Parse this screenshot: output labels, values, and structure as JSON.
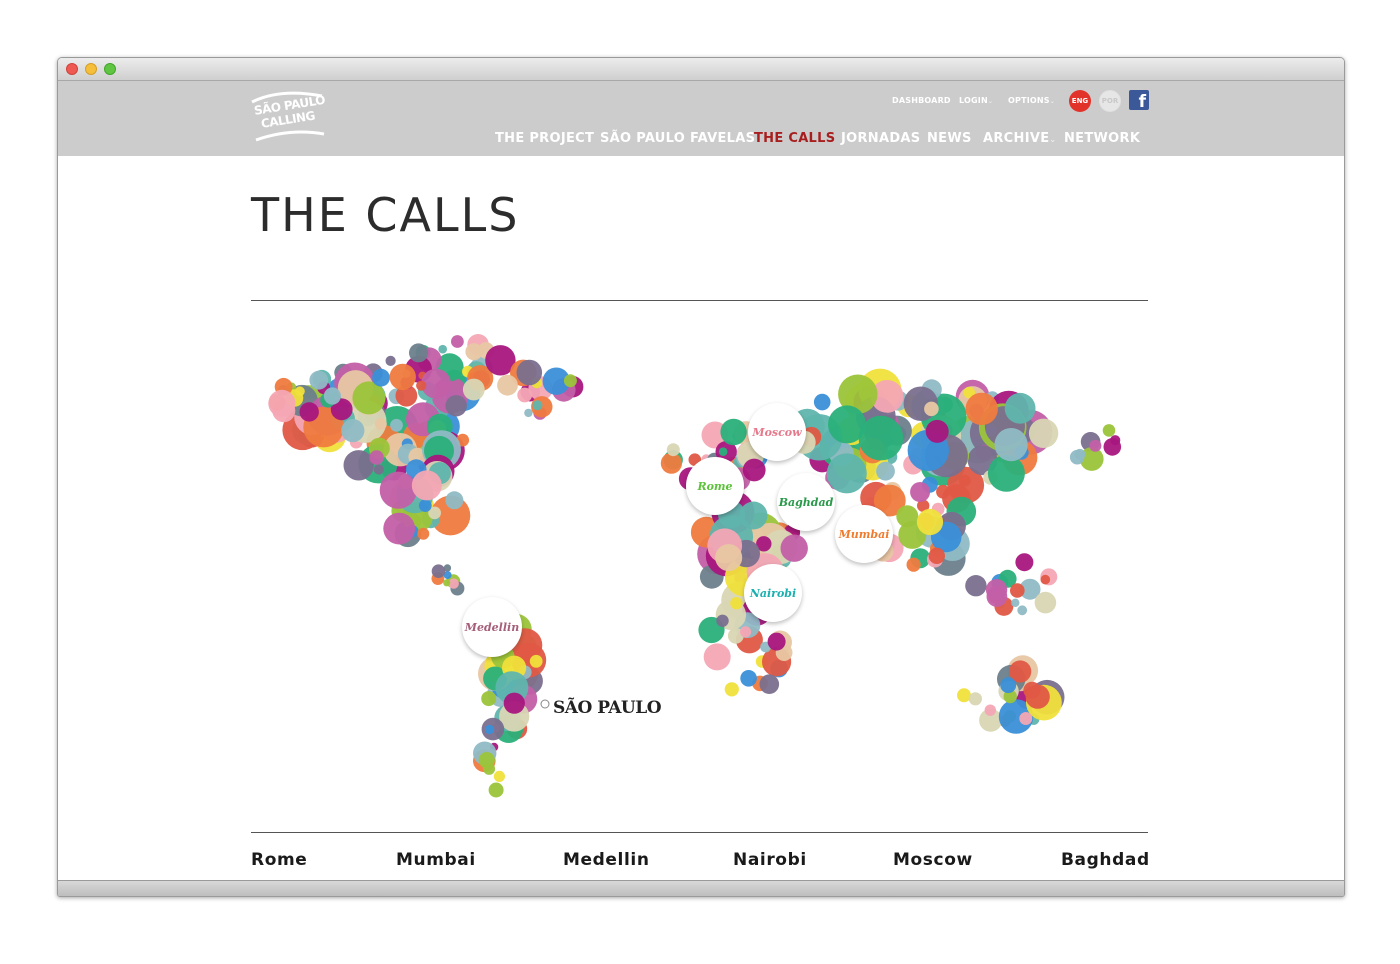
{
  "header": {
    "logo_line1": "SÃO PAULO",
    "logo_line2": "CALLING",
    "util": {
      "dashboard": "DASHBOARD",
      "login": "LOGIN",
      "options": "OPTIONS"
    },
    "lang": {
      "eng": "ENG",
      "por": "POR"
    },
    "facebook": "f",
    "nav": [
      {
        "label": "THE PROJECT"
      },
      {
        "label": "SÃO PAULO FAVELAS"
      },
      {
        "label": "THE CALLS",
        "active": true
      },
      {
        "label": "JORNADAS"
      },
      {
        "label": "NEWS"
      },
      {
        "label": "ARCHIVE"
      },
      {
        "label": "NETWORK"
      }
    ],
    "active_color": "#a81e1e"
  },
  "page": {
    "title": "THE CALLS",
    "home_city": "SÃO PAULO",
    "map_badges": [
      {
        "label": "Moscow",
        "color": "#e5788a"
      },
      {
        "label": "Rome",
        "color": "#5cc23a"
      },
      {
        "label": "Baghdad",
        "color": "#2a9a4a"
      },
      {
        "label": "Mumbai",
        "color": "#ef7b2e"
      },
      {
        "label": "Nairobi",
        "color": "#1bb0b0"
      },
      {
        "label": "Medellin",
        "color": "#a65f7a"
      }
    ],
    "cities": [
      "Rome",
      "Mumbai",
      "Medellin",
      "Nairobi",
      "Moscow",
      "Baghdad"
    ]
  },
  "palette": [
    "#8fbac5",
    "#ef7b3f",
    "#9bc43a",
    "#a8167e",
    "#f0e03b",
    "#7a6f8e",
    "#e05845",
    "#5fb5ad",
    "#d9d6b4",
    "#3a8fd8",
    "#c35fa8",
    "#e8c7a3",
    "#6b7f8b",
    "#f4a6b4",
    "#2ab07a"
  ]
}
